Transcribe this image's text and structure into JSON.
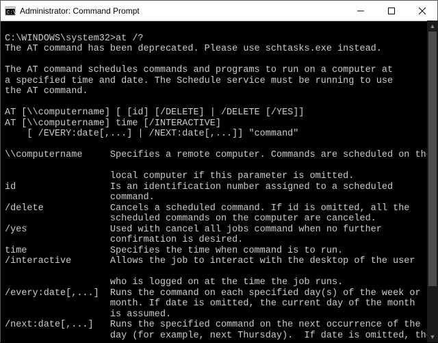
{
  "window": {
    "title": "Administrator: Command Prompt"
  },
  "terminal": {
    "prompt": "C:\\WINDOWS\\system32>",
    "command": "at /?",
    "lines": [
      "The AT command has been deprecated. Please use schtasks.exe instead.",
      "",
      "The AT command schedules commands and programs to run on a computer at",
      "a specified time and date. The Schedule service must be running to use",
      "the AT command.",
      "",
      "AT [\\\\computername] [ [id] [/DELETE] | /DELETE [/YES]]",
      "AT [\\\\computername] time [/INTERACTIVE]",
      "    [ /EVERY:date[,...] | /NEXT:date[,...]] \"command\"",
      "",
      "\\\\computername     Specifies a remote computer. Commands are scheduled on the",
      "",
      "                   local computer if this parameter is omitted.",
      "id                 Is an identification number assigned to a scheduled",
      "                   command.",
      "/delete            Cancels a scheduled command. If id is omitted, all the",
      "                   scheduled commands on the computer are canceled.",
      "/yes               Used with cancel all jobs command when no further",
      "                   confirmation is desired.",
      "time               Specifies the time when command is to run.",
      "/interactive       Allows the job to interact with the desktop of the user",
      "",
      "                   who is logged on at the time the job runs.",
      "/every:date[,...]  Runs the command on each specified day(s) of the week or",
      "                   month. If date is omitted, the current day of the month",
      "                   is assumed.",
      "/next:date[,...]   Runs the specified command on the next occurrence of the",
      "                   day (for example, next Thursday).  If date is omitted, the"
    ]
  }
}
